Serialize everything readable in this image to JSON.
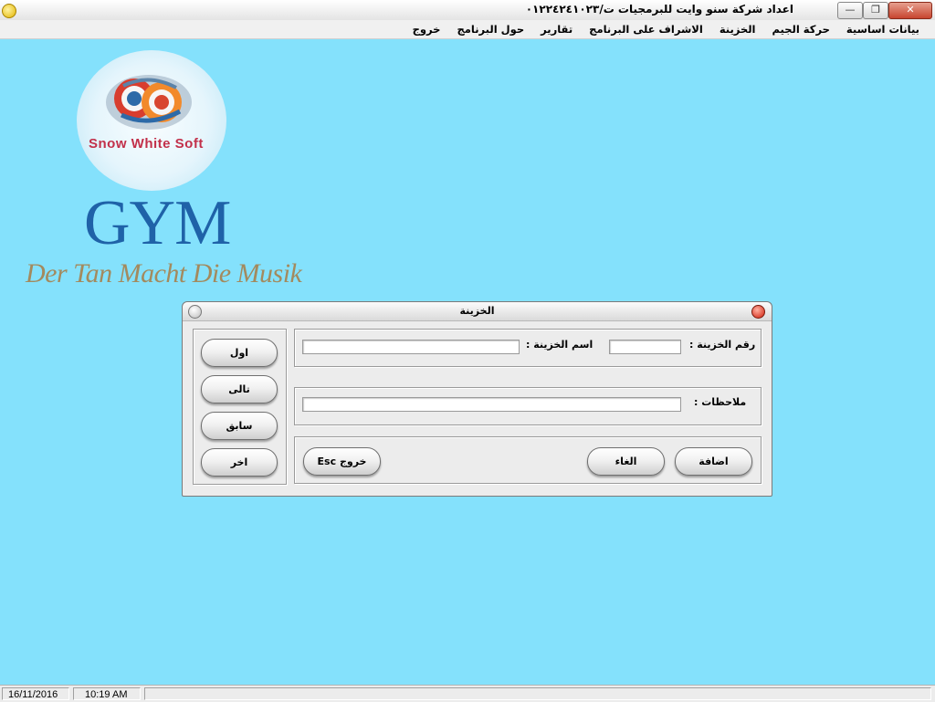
{
  "window": {
    "title": "اعداد شركة سنو وايت للبرمجيات ت/٠١٢٢٤٢٤١٠٢٣",
    "minimize_glyph": "—",
    "maximize_glyph": "❐",
    "close_glyph": "✕"
  },
  "menu": {
    "items": [
      {
        "label": "بيانات اساسية"
      },
      {
        "label": "حركة الجيم"
      },
      {
        "label": "الخزينة"
      },
      {
        "label": "الاشراف على البرنامج"
      },
      {
        "label": "تقارير"
      },
      {
        "label": "حول البرنامج"
      },
      {
        "label": "خروج"
      }
    ]
  },
  "branding": {
    "company_logo_text": "Snow White Soft",
    "product_title": "GYM",
    "tagline": "Der Tan Macht Die Musik"
  },
  "dialog": {
    "title": "الخزينة",
    "treasury_number_label": "رقم الخزينة  :",
    "treasury_number_value": "",
    "treasury_name_label": "اسم الخزينة  :",
    "treasury_name_value": "",
    "notes_label": "ملاحظات  :",
    "notes_value": "",
    "nav": {
      "first": "اول",
      "next": "تالى",
      "previous": "سابق",
      "last": "اخر"
    },
    "actions": {
      "add": "اضافة",
      "cancel": "الغاء",
      "exit": "خروج Esc"
    }
  },
  "status": {
    "date": "16/11/2016",
    "time": "10:19 AM"
  },
  "colors": {
    "desktop_background": "#84e1fc",
    "brand_blue": "#1f62a8",
    "brand_red": "#c2304a",
    "tagline_gold": "#a38a5e"
  }
}
